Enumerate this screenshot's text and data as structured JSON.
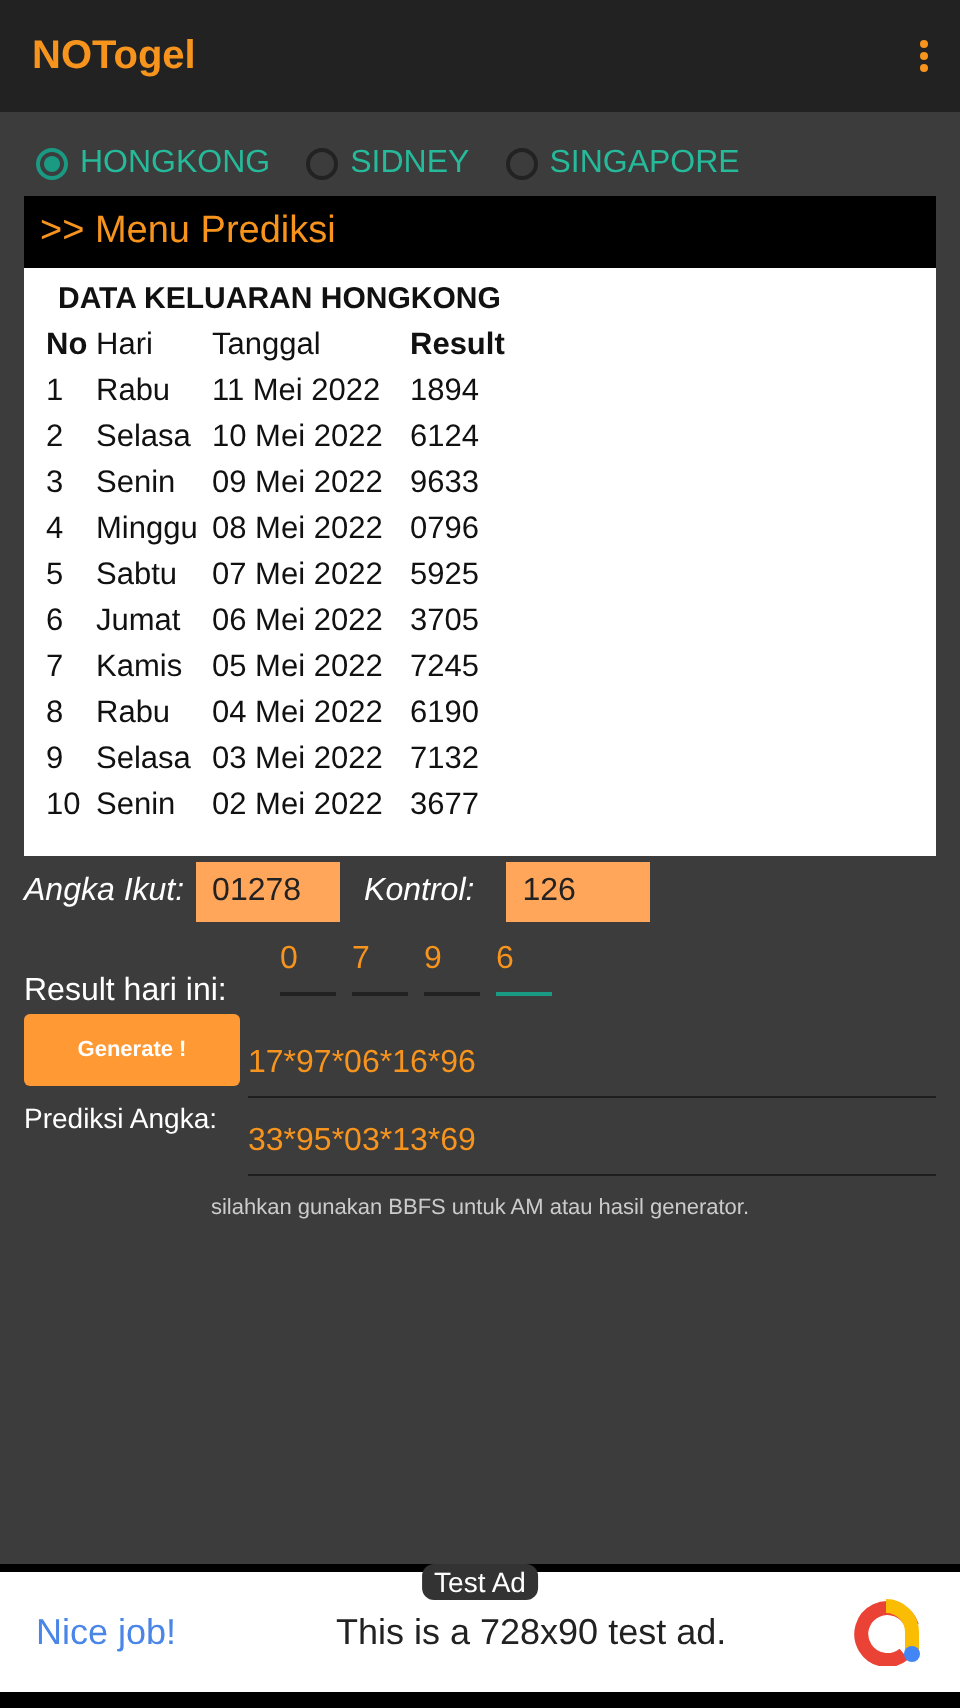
{
  "app_bar": {
    "title": "NOTogel"
  },
  "markets": [
    {
      "label": "HONGKONG",
      "selected": true
    },
    {
      "label": "SIDNEY",
      "selected": false
    },
    {
      "label": "SINGAPORE",
      "selected": false
    }
  ],
  "menu_header": ">> Menu Prediksi",
  "table": {
    "title": "DATA KELUARAN HONGKONG",
    "columns": [
      "No",
      "Hari",
      "Tanggal",
      "Result"
    ],
    "rows": [
      [
        "1",
        "Rabu",
        "11 Mei 2022",
        "1894"
      ],
      [
        "2",
        "Selasa",
        "10 Mei 2022",
        "6124"
      ],
      [
        "3",
        "Senin",
        "09 Mei 2022",
        "9633"
      ],
      [
        "4",
        "Minggu",
        "08 Mei 2022",
        "0796"
      ],
      [
        "5",
        "Sabtu",
        "07 Mei 2022",
        "5925"
      ],
      [
        "6",
        "Jumat",
        "06 Mei 2022",
        "3705"
      ],
      [
        "7",
        "Kamis",
        "05 Mei 2022",
        "7245"
      ],
      [
        "8",
        "Rabu",
        "04 Mei 2022",
        "6190"
      ],
      [
        "9",
        "Selasa",
        "03 Mei 2022",
        "7132"
      ],
      [
        "10",
        "Senin",
        "02 Mei 2022",
        "3677"
      ]
    ]
  },
  "angka_ikut": {
    "label": "Angka Ikut:",
    "value": "01278"
  },
  "kontrol": {
    "label": "Kontrol:",
    "value": "126"
  },
  "result_today": {
    "label": "Result hari ini:",
    "digits": [
      {
        "value": "0",
        "focused": false
      },
      {
        "value": "7",
        "focused": false
      },
      {
        "value": "9",
        "focused": false
      },
      {
        "value": "6",
        "focused": true
      }
    ]
  },
  "generate_button": "Generate !",
  "prediction": {
    "label": "Prediksi Angka:",
    "values": [
      "17*97*06*16*96",
      "33*95*03*13*69"
    ]
  },
  "note": "silahkan gunakan BBFS untuk AM atau hasil generator.",
  "ad": {
    "badge": "Test Ad",
    "headline": "Nice job!",
    "text": "This is a 728x90 test ad."
  }
}
